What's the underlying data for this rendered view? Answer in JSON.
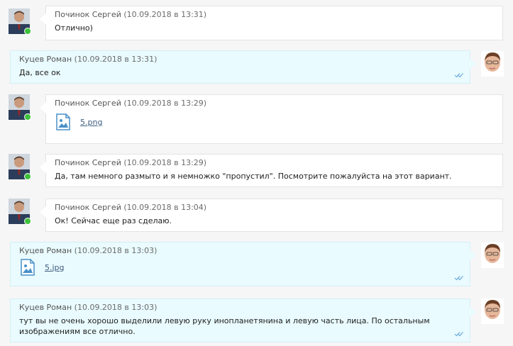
{
  "messages": [
    {
      "author": "Починок Сергей",
      "time": "(10.09.2018 в 13:31)",
      "text": "Отлично)"
    },
    {
      "author": "Куцев Роман",
      "time": "(10.09.2018 в 13:31)",
      "text": "Да, все ок"
    },
    {
      "author": "Починок Сергей",
      "time": "(10.09.2018 в 13:29)",
      "file": "5.png"
    },
    {
      "author": "Починок Сергей",
      "time": "(10.09.2018 в 13:29)",
      "text": "Да, там немного размыто и я немножко \"пропустил\". Посмотрите пожалуйста на этот вариант."
    },
    {
      "author": "Починок Сергей",
      "time": "(10.09.2018 в 13:04)",
      "text": "Ок! Сейчас еще раз сделаю."
    },
    {
      "author": "Куцев Роман",
      "time": "(10.09.2018 в 13:03)",
      "file": "5.jpg"
    },
    {
      "author": "Куцев Роман",
      "time": "(10.09.2018 в 13:03)",
      "text": "тут вы не очень хорошо выделили левую руку инопланетянина и левую часть лица. По остальным изображениям все отлично."
    }
  ],
  "icons": {
    "read_receipt": "double-check-icon",
    "online": "online-indicator",
    "file": "image-file-icon"
  },
  "colors": {
    "incoming_bg": "#ffffff",
    "outgoing_bg": "#e9fbff",
    "online": "#3fc13b",
    "link": "#3d5d7e",
    "check": "#6aa8d8"
  }
}
